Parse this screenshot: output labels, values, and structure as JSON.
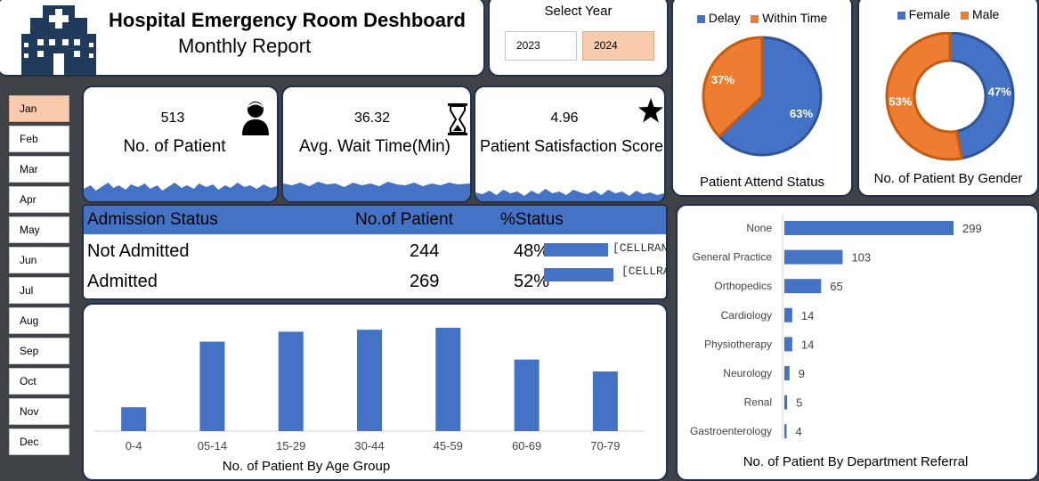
{
  "header": {
    "title": "Hospital Emergency Room Deshboard",
    "subtitle": "Monthly Report",
    "icon": "hospital-icon"
  },
  "year_selector": {
    "label": "Select Year",
    "years": [
      "2023",
      "2024"
    ],
    "selected": "2024"
  },
  "months": {
    "items": [
      "Jan",
      "Feb",
      "Mar",
      "Apr",
      "May",
      "Jun",
      "Jul",
      "Aug",
      "Sep",
      "Oct",
      "Nov",
      "Dec"
    ],
    "selected": "Jan"
  },
  "kpis": {
    "patients": {
      "value": "513",
      "label": "No. of Patient",
      "icon": "person-icon"
    },
    "wait_time": {
      "value": "36.32",
      "label": "Avg. Wait Time(Min)",
      "icon": "hourglass-icon"
    },
    "satisfaction": {
      "value": "4.96",
      "label": "Patient Satisfaction Score",
      "icon": "star-icon"
    }
  },
  "admission": {
    "headers": [
      "Admission Status",
      "No.of Patient",
      "%Status"
    ],
    "rows": [
      {
        "status": "Not Admitted",
        "count": "244",
        "percent": "48%",
        "fraction": 0.48,
        "cell": "[CELLRAN…"
      },
      {
        "status": "Admitted",
        "count": "269",
        "percent": "52%",
        "fraction": 0.52,
        "cell": "[CELLRA…"
      }
    ]
  },
  "colors": {
    "blue": "#4472c4",
    "orange": "#ed7d31",
    "panel_border": "#1f2f4f",
    "background": "#3f4246",
    "selected": "#f8cbad"
  },
  "chart_data": [
    {
      "type": "bar",
      "title": "No. of Patient By Age Group",
      "categories": [
        "0-4",
        "05-14",
        "15-29",
        "30-44",
        "45-59",
        "60-69",
        "70-79"
      ],
      "values": [
        12,
        45,
        50,
        51,
        52,
        36,
        30
      ],
      "ylim": [
        0,
        56
      ],
      "grid": false
    },
    {
      "type": "bar",
      "orientation": "horizontal",
      "title": "No. of Patient By Department Referral",
      "categories": [
        "None",
        "General Practice",
        "Orthopedics",
        "Cardiology",
        "Physiotherapy",
        "Neurology",
        "Renal",
        "Gastroenterology"
      ],
      "values": [
        299,
        103,
        65,
        14,
        14,
        9,
        5,
        4
      ],
      "grid": false
    },
    {
      "type": "pie",
      "title": "Patient Attend Status",
      "series": [
        {
          "name": "Delay",
          "value": 63,
          "label": "63%",
          "color": "#4472c4"
        },
        {
          "name": "Within Time",
          "value": 37,
          "label": "37%",
          "color": "#ed7d31"
        }
      ],
      "legend": "top"
    },
    {
      "type": "pie",
      "style": "donut",
      "title": "No. of Patient By Gender",
      "series": [
        {
          "name": "Female",
          "value": 47,
          "label": "47%",
          "color": "#4472c4"
        },
        {
          "name": "Male",
          "value": 53,
          "label": "53%",
          "color": "#ed7d31"
        }
      ],
      "legend": "top"
    }
  ]
}
